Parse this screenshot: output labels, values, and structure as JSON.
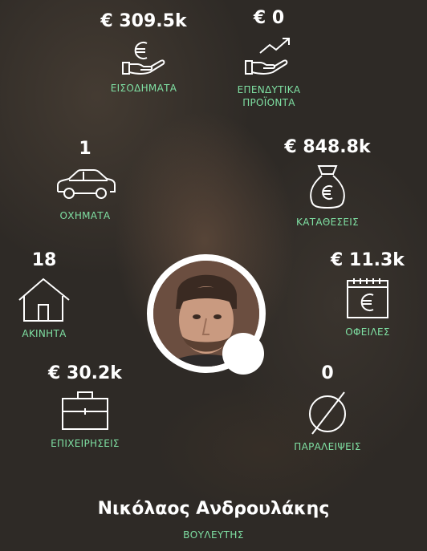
{
  "stats": {
    "income": {
      "value": "€ 309.5k",
      "label": "ΕΙΣΟΔΗΜΑΤΑ",
      "icon": "hand-euro-icon"
    },
    "investments": {
      "value": "€ 0",
      "label_line1": "ΕΠΕΝΔΥΤΙΚΑ",
      "label_line2": "ΠΡΟΪΟΝΤΑ",
      "icon": "hand-growth-icon"
    },
    "vehicles": {
      "value": "1",
      "label": "ΟΧΗΜΑΤΑ",
      "icon": "car-icon"
    },
    "deposits": {
      "value": "€ 848.8k",
      "label": "ΚΑΤΑΘΕΣΕΙΣ",
      "icon": "money-bag-icon"
    },
    "properties": {
      "value": "18",
      "label": "ΑΚΙΝΗΤΑ",
      "icon": "house-icon"
    },
    "debts": {
      "value": "€ 11.3k",
      "label": "ΟΦΕΙΛΕΣ",
      "icon": "calendar-euro-icon"
    },
    "businesses": {
      "value": "€ 30.2k",
      "label": "ΕΠΙΧΕΙΡΗΣΕΙΣ",
      "icon": "briefcase-icon"
    },
    "omissions": {
      "value": "0",
      "label": "ΠΑΡΑΛΕΙΨΕΙΣ",
      "icon": "empty-set-icon"
    }
  },
  "person": {
    "name": "Νικόλαος Ανδρουλάκης",
    "role": "ΒΟΥΛΕΥΤΗΣ"
  },
  "colors": {
    "label_green": "#7fe0a3",
    "value_white": "#ffffff"
  }
}
